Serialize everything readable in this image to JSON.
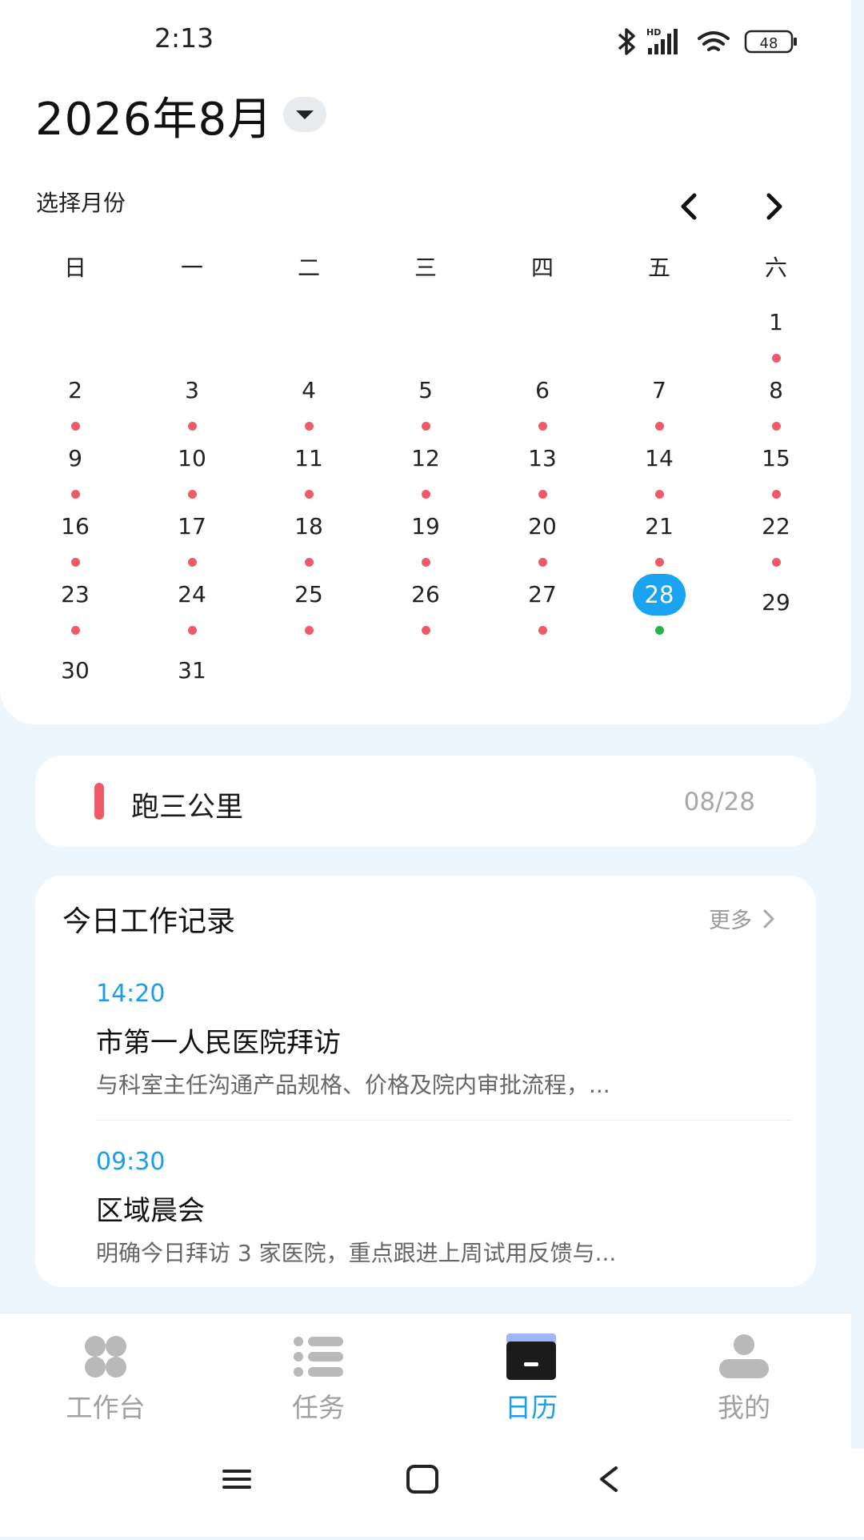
{
  "status_bar": {
    "time": "2:13",
    "battery": "48"
  },
  "header": {
    "month_title": "2026年8月",
    "select_month_label": "选择月份"
  },
  "calendar": {
    "weekdays": [
      "日",
      "一",
      "二",
      "三",
      "四",
      "五",
      "六"
    ],
    "days": [
      "1",
      "2",
      "3",
      "4",
      "5",
      "6",
      "7",
      "8",
      "9",
      "10",
      "11",
      "12",
      "13",
      "14",
      "15",
      "16",
      "17",
      "18",
      "19",
      "20",
      "21",
      "22",
      "23",
      "24",
      "25",
      "26",
      "27",
      "28",
      "29",
      "30",
      "31"
    ],
    "selected_day": "28",
    "colors": {
      "event_dot": "#ef5a68",
      "today_dot": "#29b14a",
      "selected": "#1aa3f1"
    }
  },
  "task": {
    "title": "跑三公里",
    "date": "08/28",
    "color": "#ef5a68"
  },
  "work_log": {
    "title": "今日工作记录",
    "more_label": "更多",
    "entries": [
      {
        "time": "14:20",
        "title": "市第一人民医院拜访",
        "desc": "与科室主任沟通产品规格、价格及院内审批流程，..."
      },
      {
        "time": "09:30",
        "title": "区域晨会",
        "desc": "明确今日拜访 3 家医院，重点跟进上周试用反馈与..."
      }
    ]
  },
  "bottom_nav": {
    "tabs": [
      {
        "label": "工作台",
        "icon": "dashboard-icon"
      },
      {
        "label": "任务",
        "icon": "list-icon"
      },
      {
        "label": "日历",
        "icon": "calendar-icon",
        "active": true
      },
      {
        "label": "我的",
        "icon": "person-icon"
      }
    ]
  }
}
